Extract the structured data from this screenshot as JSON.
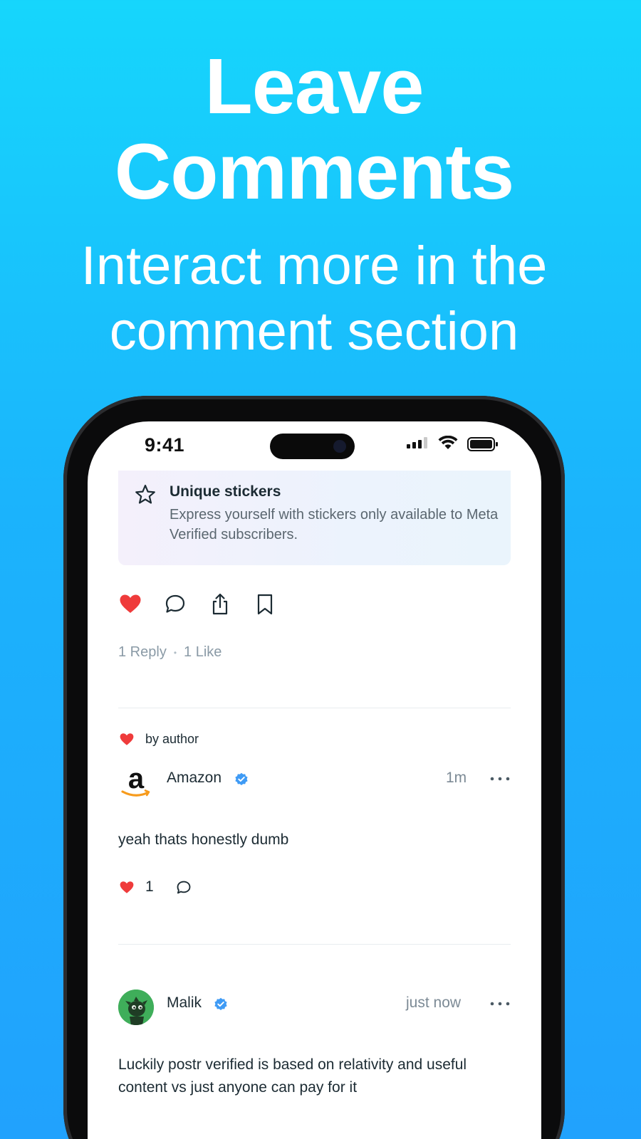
{
  "promo": {
    "title": "Leave Comments",
    "subtitle": "Interact more in the comment section"
  },
  "status_bar": {
    "time": "9:41"
  },
  "sticker_card": {
    "icon": "star-icon",
    "title": "Unique stickers",
    "description": "Express yourself with stickers only available to Meta Verified subscribers."
  },
  "post_actions": [
    "heart-icon",
    "comment-icon",
    "share-icon",
    "bookmark-icon"
  ],
  "post_stats": {
    "replies": "1 Reply",
    "separator": "•",
    "likes": "1 Like"
  },
  "comments": [
    {
      "liked_by_label": "by author",
      "author": "Amazon",
      "verified": true,
      "time": "1m",
      "text": "yeah thats honestly dumb",
      "like_count": "1"
    },
    {
      "author": "Malik",
      "verified": true,
      "time": "just now",
      "text": "Luckily postr verified is based on relativity and useful content vs just anyone can pay for it"
    }
  ],
  "colors": {
    "background_top": "#16d6fc",
    "background_bottom": "#21a2fd",
    "like_red": "#ef3b3b",
    "verified_blue": "#3f9bf5",
    "text_primary": "#1c2b33",
    "text_muted": "#8a9aa6"
  }
}
